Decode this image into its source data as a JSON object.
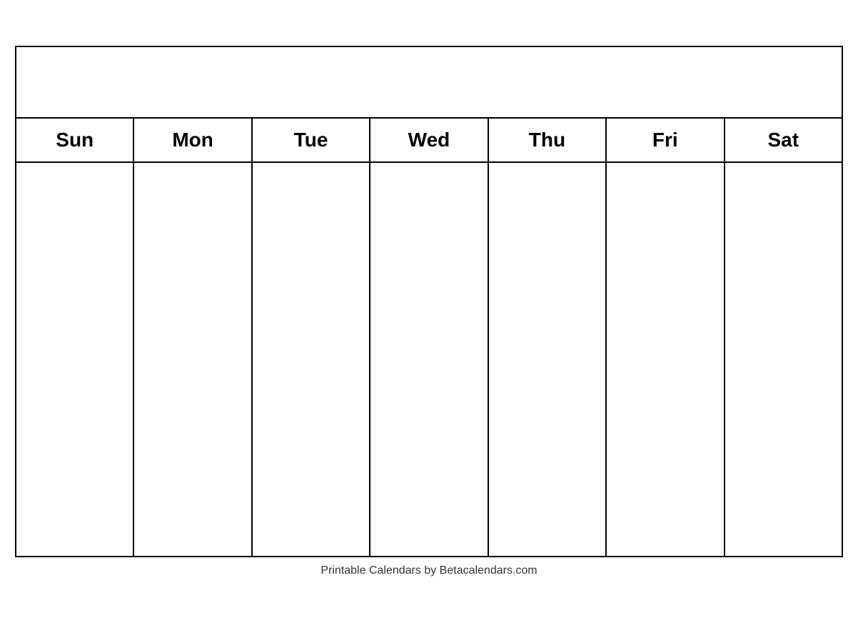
{
  "calendar": {
    "title": "",
    "days": [
      "Sun",
      "Mon",
      "Tue",
      "Wed",
      "Thu",
      "Fri",
      "Sat"
    ],
    "rows": 5
  },
  "footer": {
    "text": "Printable Calendars by Betacalendars.com"
  }
}
